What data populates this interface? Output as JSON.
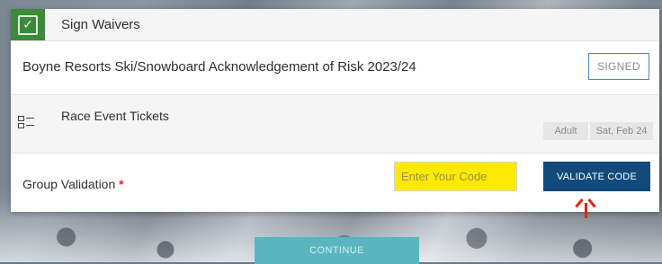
{
  "sections": {
    "waivers": {
      "title": "Sign Waivers",
      "check_icon": "check-icon",
      "status_color": "#3c8a3a"
    },
    "waiver_item": {
      "name": "Boyne Resorts Ski/Snowboard Acknowledgement of Risk 2023/24",
      "status_label": "SIGNED"
    },
    "tickets": {
      "icon": "checklist-icon",
      "title": "Race Event Tickets",
      "badges": [
        "Adult",
        "Sat, Feb 24"
      ]
    },
    "group_validation": {
      "label": "Group Validation",
      "required_marker": "*",
      "input": {
        "placeholder": "Enter Your Code",
        "value": ""
      },
      "button_label": "VALIDATE CODE",
      "button_color": "#124a7c",
      "highlight_color": "#fde902"
    }
  },
  "annotation": {
    "icon": "arrow-up-icon",
    "color": "#e3201b"
  },
  "footer": {
    "continue_label": "CONTINUE"
  }
}
